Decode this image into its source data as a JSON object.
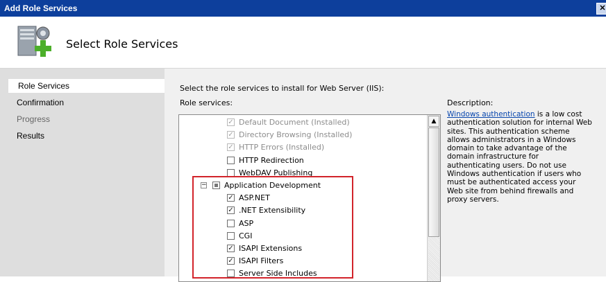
{
  "window": {
    "title": "Add Role Services",
    "close_glyph": "✕"
  },
  "header": {
    "title": "Select Role Services",
    "icon": "server-add-icon"
  },
  "sidebar": {
    "items": [
      {
        "label": "Role Services",
        "state": "active"
      },
      {
        "label": "Confirmation",
        "state": "normal"
      },
      {
        "label": "Progress",
        "state": "dim"
      },
      {
        "label": "Results",
        "state": "normal"
      }
    ]
  },
  "main": {
    "prompt": "Select the role services to install for Web Server (IIS):",
    "role_services_label": "Role services:",
    "description_label": "Description:",
    "description_link": "Windows authentication",
    "description_text": " is a low cost authentication solution for internal Web sites. This authentication scheme allows administrators in a Windows domain to take advantage of the domain infrastructure for authenticating users. Do not use Windows authentication if users who must be authenticated access your Web site from behind firewalls and proxy servers."
  },
  "list": {
    "items": [
      {
        "label": "Default Document  (Installed)",
        "checked": true,
        "dim": true,
        "indent": 2
      },
      {
        "label": "Directory Browsing  (Installed)",
        "checked": true,
        "dim": true,
        "indent": 2
      },
      {
        "label": "HTTP Errors  (Installed)",
        "checked": true,
        "dim": true,
        "indent": 2
      },
      {
        "label": "HTTP Redirection",
        "checked": false,
        "dim": false,
        "indent": 2
      },
      {
        "label": "WebDAV Publishing",
        "checked": false,
        "dim": false,
        "indent": 2
      },
      {
        "label": "Application Development",
        "checked": "partial",
        "dim": false,
        "indent": 1,
        "expander": "−"
      },
      {
        "label": "ASP.NET",
        "checked": true,
        "dim": false,
        "indent": 2
      },
      {
        "label": ".NET Extensibility",
        "checked": true,
        "dim": false,
        "indent": 2
      },
      {
        "label": "ASP",
        "checked": false,
        "dim": false,
        "indent": 2
      },
      {
        "label": "CGI",
        "checked": false,
        "dim": false,
        "indent": 2
      },
      {
        "label": "ISAPI Extensions",
        "checked": true,
        "dim": false,
        "indent": 2
      },
      {
        "label": "ISAPI Filters",
        "checked": true,
        "dim": false,
        "indent": 2
      },
      {
        "label": "Server Side Includes",
        "checked": false,
        "dim": false,
        "indent": 2
      }
    ],
    "check_glyph": "✓",
    "scroll_up_glyph": "▲"
  },
  "colors": {
    "titlebar": "#0d3f9c",
    "highlight": "#d2232a",
    "link": "#0645ad"
  }
}
